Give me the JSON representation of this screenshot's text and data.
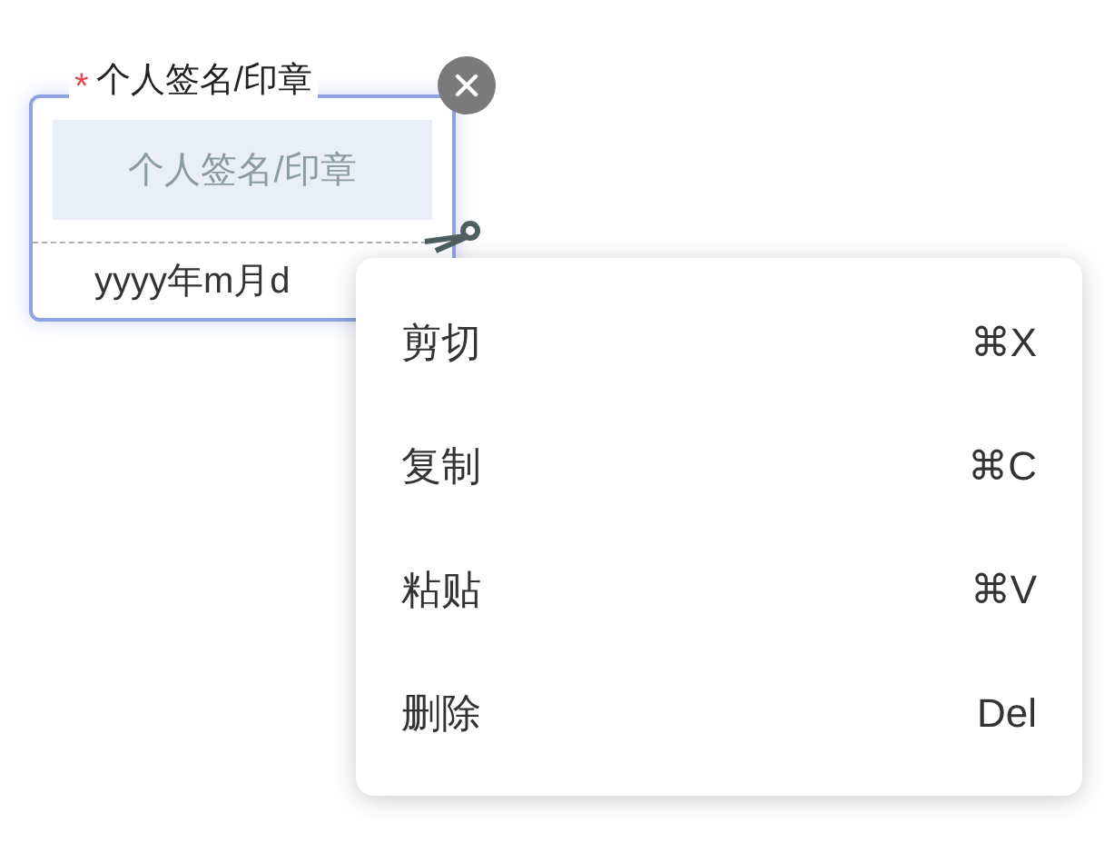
{
  "field": {
    "required_mark": "*",
    "label": "个人签名/印章",
    "signature_placeholder": "个人签名/印章",
    "date_text": "yyyy年m月d"
  },
  "context_menu": {
    "items": [
      {
        "label": "剪切",
        "shortcut": "⌘X"
      },
      {
        "label": "复制",
        "shortcut": "⌘C"
      },
      {
        "label": "粘贴",
        "shortcut": "⌘V"
      },
      {
        "label": "删除",
        "shortcut": "Del"
      }
    ]
  }
}
